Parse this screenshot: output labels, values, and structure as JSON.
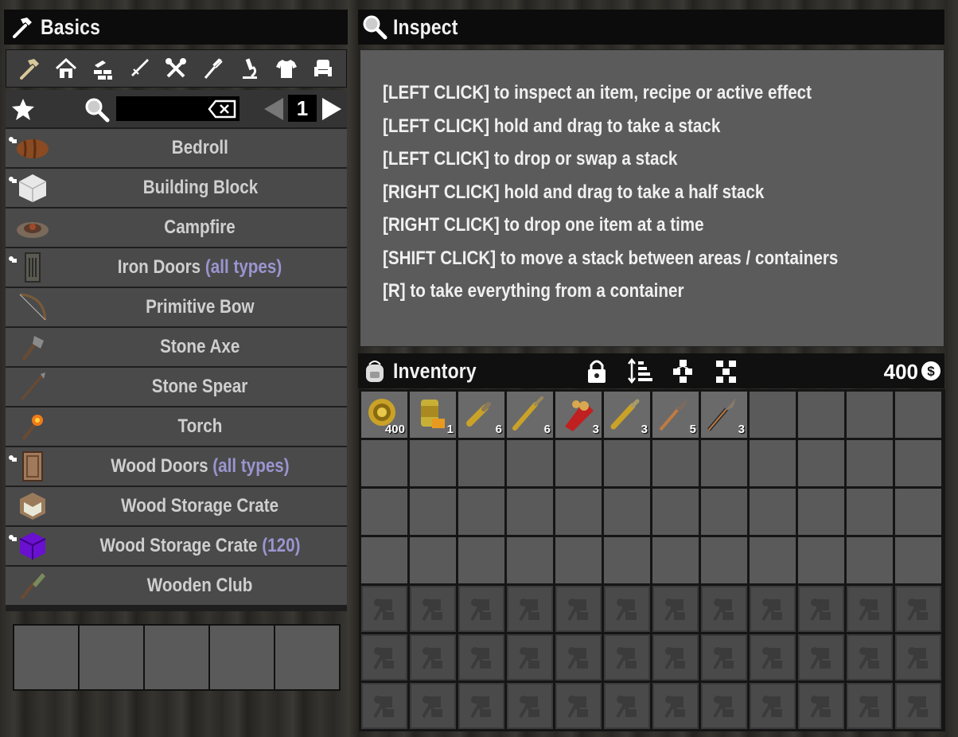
{
  "crafting": {
    "title": "Basics",
    "categories": [
      "basics",
      "building",
      "resources",
      "weapons",
      "tools",
      "food",
      "science",
      "clothing",
      "decor"
    ],
    "page_number": "1",
    "search_value": "",
    "recipes": [
      {
        "name": "Bedroll",
        "variant": "",
        "icon": "bedroll-icon",
        "unlocked_mark": true
      },
      {
        "name": "Building Block",
        "variant": "",
        "icon": "building-block-icon",
        "unlocked_mark": true
      },
      {
        "name": "Campfire",
        "variant": "",
        "icon": "campfire-icon",
        "unlocked_mark": false
      },
      {
        "name": "Iron Doors",
        "variant": "(all types)",
        "icon": "iron-door-icon",
        "unlocked_mark": true
      },
      {
        "name": "Primitive Bow",
        "variant": "",
        "icon": "bow-icon",
        "unlocked_mark": false
      },
      {
        "name": "Stone Axe",
        "variant": "",
        "icon": "stone-axe-icon",
        "unlocked_mark": false
      },
      {
        "name": "Stone Spear",
        "variant": "",
        "icon": "spear-icon",
        "unlocked_mark": false
      },
      {
        "name": "Torch",
        "variant": "",
        "icon": "torch-icon",
        "unlocked_mark": false
      },
      {
        "name": "Wood Doors",
        "variant": "(all types)",
        "icon": "wood-door-icon",
        "unlocked_mark": true
      },
      {
        "name": "Wood Storage Crate",
        "variant": "",
        "icon": "crate-icon",
        "unlocked_mark": false
      },
      {
        "name": "Wood Storage Crate",
        "variant": "(120)",
        "icon": "purple-crate-icon",
        "unlocked_mark": true
      },
      {
        "name": "Wooden Club",
        "variant": "",
        "icon": "club-icon",
        "unlocked_mark": false
      }
    ]
  },
  "inspect": {
    "title": "Inspect",
    "lines": [
      "[LEFT CLICK] to inspect an item, recipe or active effect",
      "[LEFT CLICK] hold and drag to take a stack",
      "[LEFT CLICK] to drop or swap a stack",
      "[RIGHT CLICK] hold and drag to take a half stack",
      "[RIGHT CLICK] to drop one item at a time",
      "[SHIFT CLICK] to move a stack between areas / containers",
      "[R] to take everything from a container"
    ]
  },
  "inventory": {
    "title": "Inventory",
    "currency": "400",
    "items": [
      {
        "name": "casino-coin",
        "count": "400"
      },
      {
        "name": "canned-food",
        "count": "1"
      },
      {
        "name": "pistol-bullet",
        "count": "6"
      },
      {
        "name": "rifle-bullet",
        "count": "6"
      },
      {
        "name": "shotgun-shell-pack",
        "count": "3"
      },
      {
        "name": "magnum-bullet",
        "count": "3"
      },
      {
        "name": "stone-arrow",
        "count": "5"
      },
      {
        "name": "flaming-arrow",
        "count": "3"
      }
    ]
  },
  "colors": {
    "header_bg": "#0c0c0c",
    "panel_bg": "#5b5b5b",
    "row_bg": "#4a4a4a",
    "variant_text": "#9a95d0",
    "slot_bg": "#5a5a5a"
  }
}
